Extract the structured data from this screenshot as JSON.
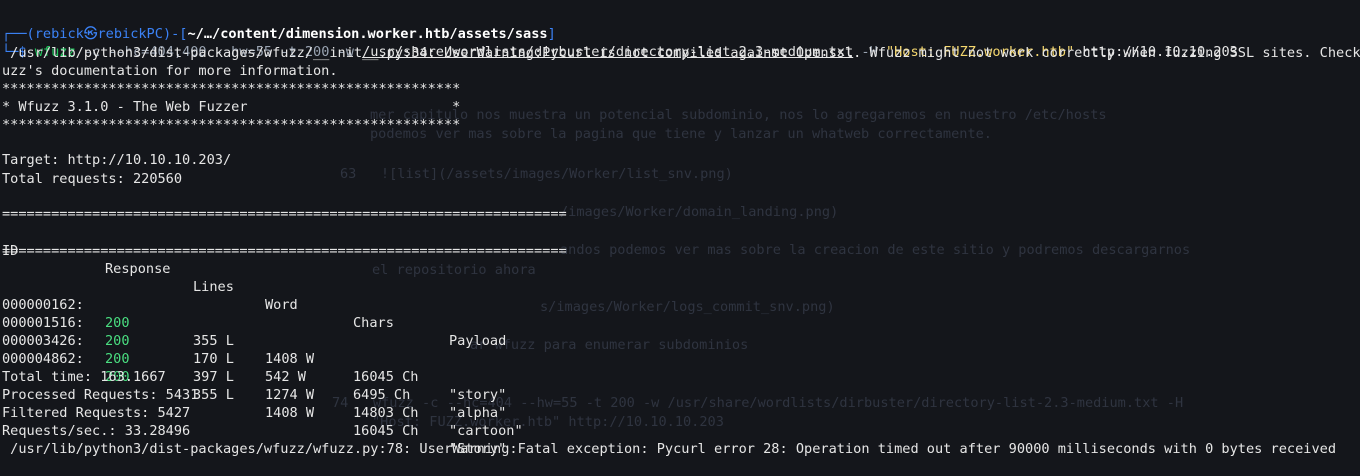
{
  "prompt": {
    "user": "rebick",
    "at": "㉿",
    "host": "rebickPC",
    "path": "~/…/content/dimension.worker.htb/assets/sass",
    "command_parts": {
      "cmd": "wfuzz",
      "opts1": " -c --hc=404,400 --hw=55 -t 200 -w ",
      "wordlist": "/usr/share/wordlists/dirbuster/directory-list-2.3-medium.txt",
      "opts2": " -H ",
      "header": "\"Host: FUZZ.worker.htb\"",
      "url": " http://10.10.10.203"
    }
  },
  "warning1_a": " /usr/lib/python3/dist-packages/wfuzz/__init__.py:34: UserWarning:Pycurl is not compiled against Openssl. Wfuzz might not work correctly when fuzzing SSL sites. Check Wf",
  "warning1_b": "uzz's documentation for more information.",
  "stars": "********************************************************",
  "banner": "* Wfuzz 3.1.0 - The Web Fuzzer                         *",
  "target": "Target: http://10.10.10.203/",
  "total_requests": "Total requests: 220560",
  "sep": "=====================================================================",
  "headers": {
    "id": "ID",
    "response": "Response",
    "lines": "Lines",
    "word": "Word",
    "chars": "Chars",
    "payload": "Payload"
  },
  "rows": [
    {
      "id": "000000162:",
      "response": "200",
      "lines": "355 L",
      "word": "1408 W",
      "chars": "16045 Ch",
      "payload": "\"story\""
    },
    {
      "id": "000001516:",
      "response": "200",
      "lines": "170 L",
      "word": "542 W",
      "chars": "6495 Ch",
      "payload": "\"alpha\""
    },
    {
      "id": "000003426:",
      "response": "200",
      "lines": "397 L",
      "word": "1274 W",
      "chars": "14803 Ch",
      "payload": "\"cartoon\""
    },
    {
      "id": "000004862:",
      "response": "200",
      "lines": "355 L",
      "word": "1408 W",
      "chars": "16045 Ch",
      "payload": "\"Story\""
    }
  ],
  "total_time": "Total time: 163.1667",
  "processed": "Processed Requests: 5431",
  "filtered": "Filtered Requests: 5427",
  "rps": "Requests/sec.: 33.28496",
  "warning2": " /usr/lib/python3/dist-packages/wfuzz/wfuzz.py:78: UserWarning:Fatal exception: Pycurl error 28: Operation timed out after 90000 milliseconds with 0 bytes received"
}
